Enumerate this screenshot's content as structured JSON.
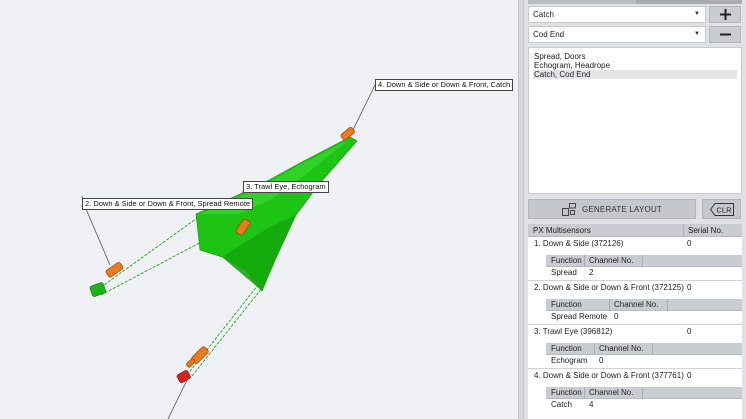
{
  "viewport": {
    "callouts": [
      "4. Down & Side or Down & Front, Catch",
      "3. Trawl Eye, Echogram",
      "2. Down & Side or Down & Front, Spread Remote"
    ]
  },
  "panel": {
    "select_1": {
      "value": "Catch"
    },
    "select_2": {
      "value": "Cod End"
    },
    "add_icon": "plus-icon",
    "remove_icon": "minus-icon",
    "layouts": [
      "Spread, Doors",
      "Echogram, Headrope",
      "Catch, Cod End"
    ],
    "generate_label": "GENERATE LAYOUT",
    "clear_label": "CLR",
    "table": {
      "header": {
        "name": "PX Multisensors",
        "serial": "Serial No."
      },
      "sub_header": {
        "function": "Function",
        "channel": "Channel No."
      },
      "sensors": [
        {
          "name": "1. Down & Side (372126)",
          "serial": "0",
          "function": "Spread",
          "channel": "2"
        },
        {
          "name": "2. Down & Side or Down & Front (372125)",
          "serial": "0",
          "function": "Spread Remote",
          "channel": "0"
        },
        {
          "name": "3. Trawl Eye (396812)",
          "serial": "0",
          "function": "Echogram",
          "channel": "0"
        },
        {
          "name": "4. Down & Side or Down & Front (377761)",
          "serial": "0",
          "function": "Catch",
          "channel": "4"
        }
      ]
    }
  },
  "colors": {
    "trawl_green": "#18c40c",
    "sensor_orange": "#e8741a",
    "door_red": "#cc1f16",
    "panel_bg": "#dfe1e4",
    "viewport_bg": "#eff1f4"
  }
}
